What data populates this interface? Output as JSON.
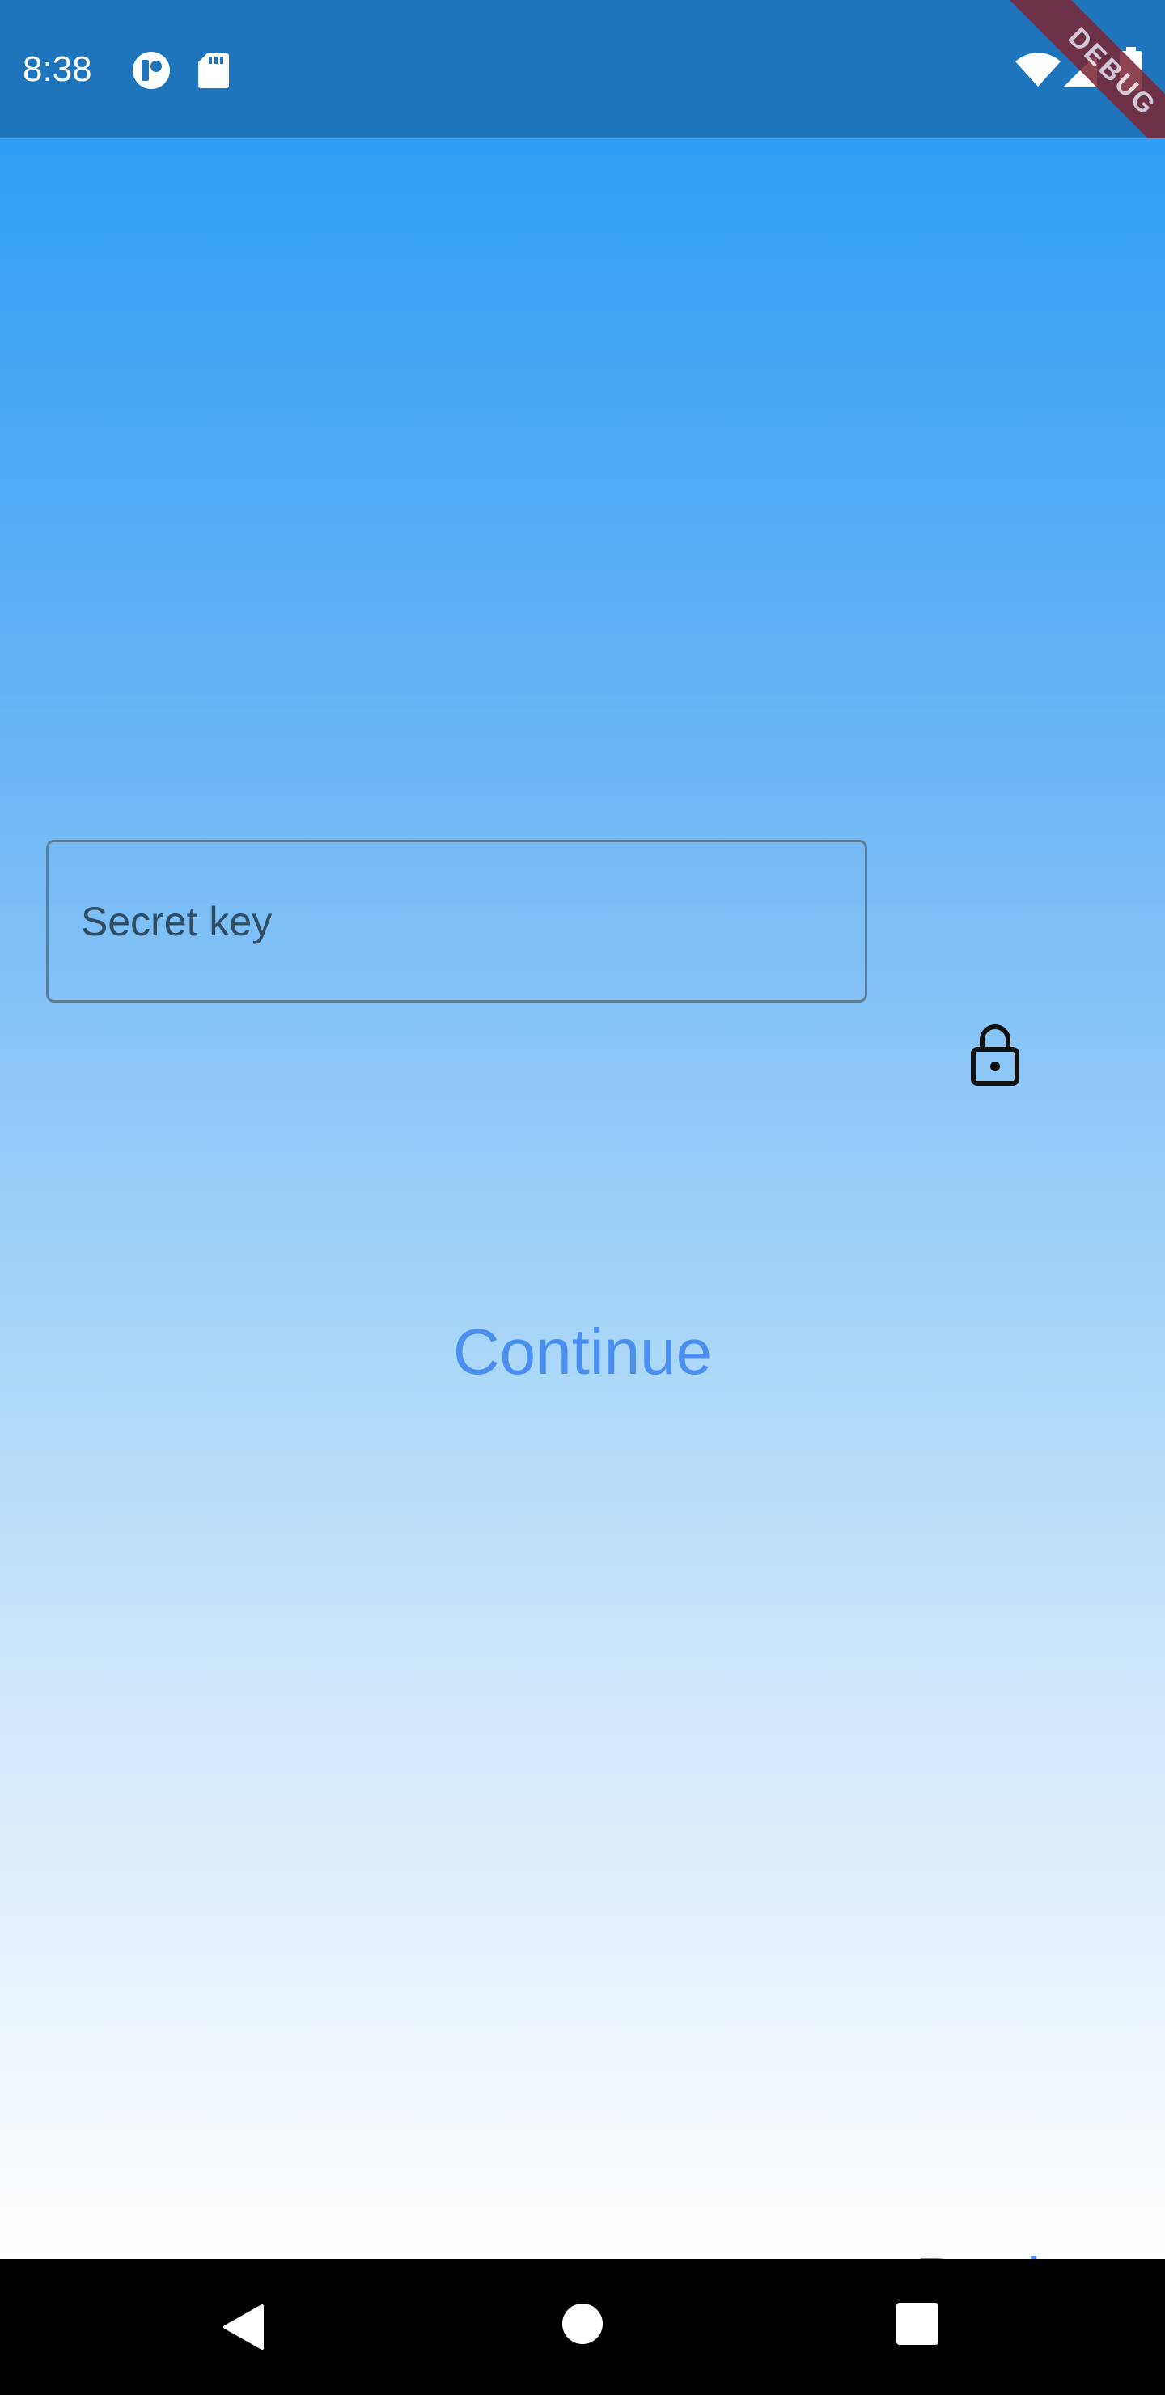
{
  "status_bar": {
    "time": "8:38",
    "background_color": "#1f75bc",
    "left_icons": [
      "app-notification-icon",
      "sd-card-icon"
    ],
    "right_icons": [
      "wifi-icon",
      "cell-signal-icon",
      "battery-icon"
    ]
  },
  "debug_banner": {
    "label": "DEBUG",
    "color": "#7a2433"
  },
  "main": {
    "secret_field": {
      "placeholder": "Secret key",
      "value": ""
    },
    "lock_icon": "lock-icon",
    "continue_label": "Continue",
    "back_label": "Back",
    "accent_color": "#4a8ef0",
    "gradient_top": "#2f9ef4",
    "gradient_bottom": "#ffffff"
  },
  "nav_bar": {
    "buttons": [
      "back-triangle-icon",
      "home-circle-icon",
      "recents-square-icon"
    ]
  }
}
